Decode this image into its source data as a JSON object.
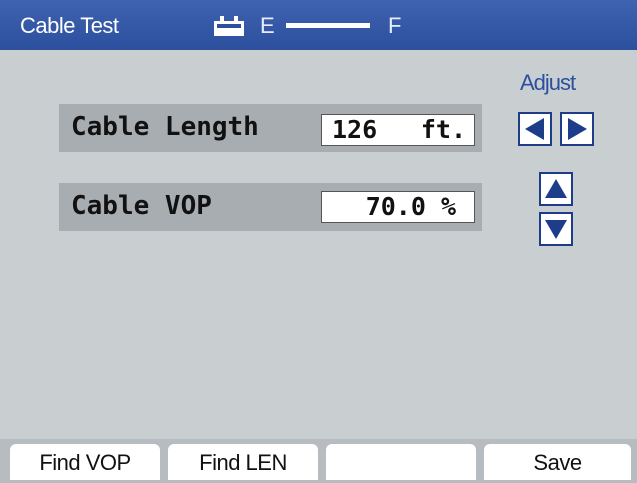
{
  "titlebar": {
    "title": "Cable Test",
    "battery": {
      "empty_label": "E",
      "full_label": "F",
      "icon": "battery-icon"
    }
  },
  "adjust": {
    "label": "Adjust",
    "icons": [
      "left-arrow-icon",
      "right-arrow-icon",
      "up-arrow-icon",
      "down-arrow-icon"
    ]
  },
  "fields": {
    "length": {
      "label": "Cable Length",
      "value": "126",
      "unit": "ft."
    },
    "vop": {
      "label": "Cable VOP",
      "value": "70.0 %"
    }
  },
  "softkeys": [
    "Find VOP",
    "Find LEN",
    "",
    "Save"
  ],
  "colors": {
    "titlebar": "#2c4f9e",
    "background": "#c9ced1",
    "accent": "#1d3d8a"
  }
}
